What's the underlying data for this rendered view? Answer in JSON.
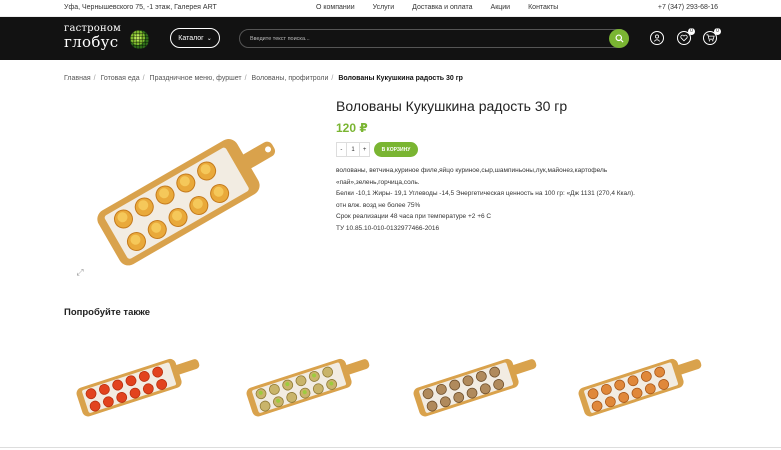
{
  "topbar": {
    "address": "Уфа, Чернышевского 75, -1 этаж, Галерея ART",
    "nav": [
      "О компании",
      "Услуги",
      "Доставка и оплата",
      "Акции",
      "Контакты"
    ],
    "phone": "+7 (347) 293-68-16"
  },
  "header": {
    "logo_line1": "гастроном",
    "logo_line2": "глобус",
    "catalog_label": "Каталог",
    "search_placeholder": "Введите текст поиска...",
    "wishlist_count": "0",
    "cart_count": "0"
  },
  "breadcrumb": [
    "Главная",
    "Готовая еда",
    "Праздничное меню, фуршет",
    "Волованы, профитроли",
    "Волованы Кукушкина радость 30 гр"
  ],
  "product": {
    "title": "Волованы Кукушкина радость 30 гр",
    "price": "120 ₽",
    "quantity": "1",
    "minus": "-",
    "plus": "+",
    "add_to_cart": "В корзину",
    "description": [
      "волованы, ветчина,куриное филе,яйцо куриное,сыр,шампиньоны,лук,майонез,картофель",
      "«пай»,зелень,горчица,соль.",
      "Белки -10,1 Жиры- 19,1 Углеводы -14,5 Энергетическая ценность на 100 гр: «Дж 1131 (270,4 Ккал).",
      "отн влж. возд не более 75%",
      "Срок реализации 48 часа при температуре +2 +6 С",
      "ТУ 10.85.10-010-0132977466-2016"
    ]
  },
  "related": {
    "title": "Попробуйте также"
  },
  "colors": {
    "accent": "#7ab532",
    "header_bg": "#121212"
  }
}
